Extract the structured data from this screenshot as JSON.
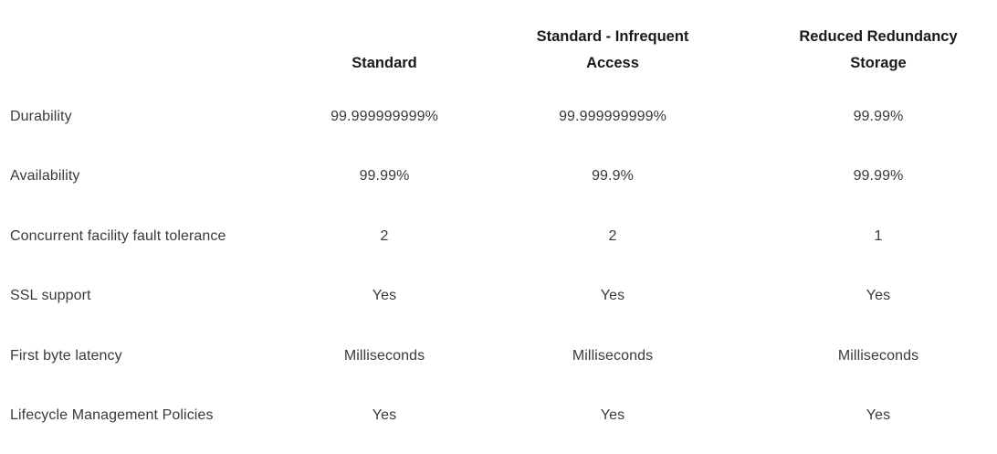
{
  "table": {
    "columns": [
      "",
      "Standard",
      "Standard - Infrequent Access",
      "Reduced Redundancy Storage"
    ],
    "rows": [
      {
        "label": "Durability",
        "standard": "99.999999999%",
        "standard_ia": "99.999999999%",
        "rrs": "99.99%"
      },
      {
        "label": "Availability",
        "standard": "99.99%",
        "standard_ia": "99.9%",
        "rrs": "99.99%"
      },
      {
        "label": "Concurrent facility fault tolerance",
        "standard": "2",
        "standard_ia": "2",
        "rrs": "1"
      },
      {
        "label": "SSL support",
        "standard": "Yes",
        "standard_ia": "Yes",
        "rrs": "Yes"
      },
      {
        "label": "First byte latency",
        "standard": "Milliseconds",
        "standard_ia": "Milliseconds",
        "rrs": "Milliseconds"
      },
      {
        "label": "Lifecycle Management Policies",
        "standard": "Yes",
        "standard_ia": "Yes",
        "rrs": "Yes"
      }
    ]
  }
}
